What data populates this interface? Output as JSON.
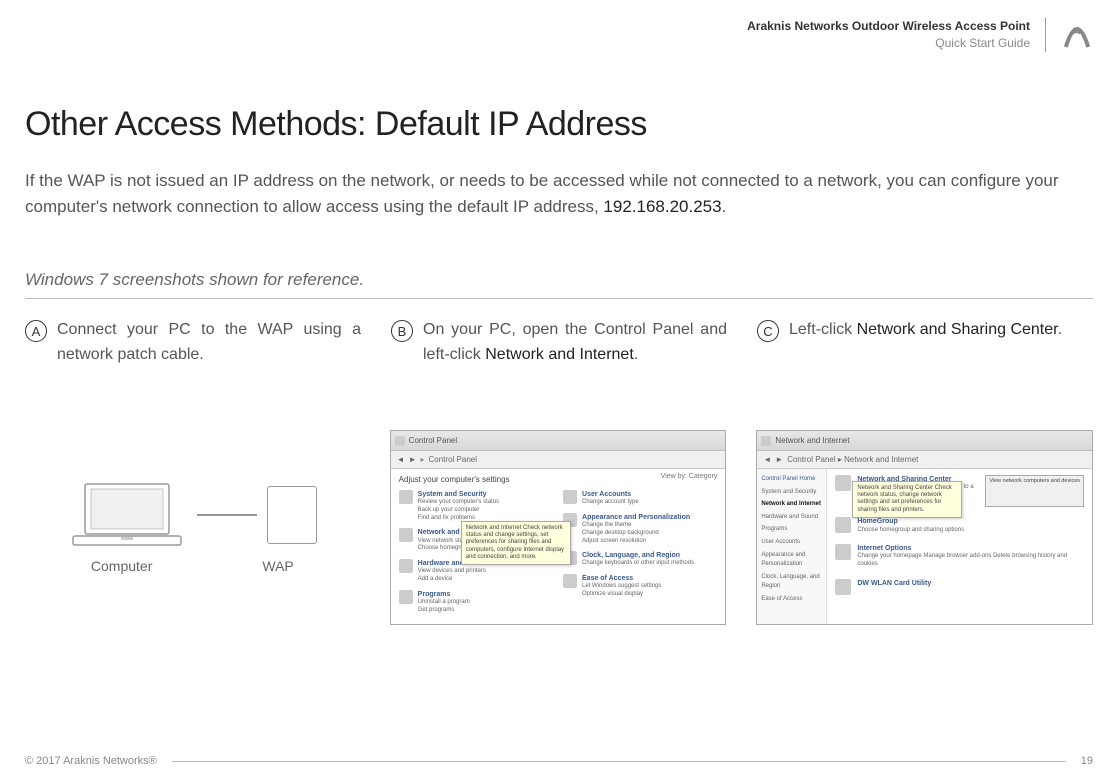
{
  "header": {
    "line1": "Araknis Networks Outdoor Wireless Access Point",
    "line2": "Quick Start Guide"
  },
  "title": "Other Access Methods: Default IP Address",
  "intro": {
    "part1": "If the WAP is not issued an IP address on the network, or needs to be accessed while not connected to a network, you can configure your computer's network connection to allow access using the default IP address, ",
    "ip": "192.168.20.253",
    "part2": "."
  },
  "caption": "Windows 7 screenshots shown for reference.",
  "steps": {
    "a": {
      "letter": "A",
      "text": "Connect your PC to the WAP using a network patch cable."
    },
    "b": {
      "letter": "B",
      "pre": "On your PC, open the Control Panel and left-click ",
      "bold": "Network and Internet",
      "post": "."
    },
    "c": {
      "letter": "C",
      "pre": "Left-click ",
      "bold": "Network and Sharing Center",
      "post": "."
    }
  },
  "diagramA": {
    "computerLabel": "Computer",
    "wapLabel": "WAP"
  },
  "screenshotB": {
    "titlebar": "Control Panel",
    "breadcrumb_arrow": "▸",
    "breadcrumb": "Control Panel",
    "heading": "Adjust your computer's settings",
    "viewby": "View by: Category",
    "cats": [
      {
        "title": "System and Security",
        "sub": "Review your computer's status\nBack up your computer\nFind and fix problems"
      },
      {
        "title": "Network and Internet",
        "sub": "View network status and tasks\nChoose homegroup and sharing options"
      },
      {
        "title": "Hardware and Sound",
        "sub": "View devices and printers\nAdd a device"
      },
      {
        "title": "Programs",
        "sub": "Uninstall a program\nGet programs"
      }
    ],
    "cats_right": [
      {
        "title": "User Accounts",
        "sub": "Change account type"
      },
      {
        "title": "Appearance and Personalization",
        "sub": "Change the theme\nChange desktop background\nAdjust screen resolution"
      },
      {
        "title": "Clock, Language, and Region",
        "sub": "Change keyboards or other input methods"
      },
      {
        "title": "Ease of Access",
        "sub": "Let Windows suggest settings\nOptimize visual display"
      }
    ],
    "tooltip": "Network and Internet\nCheck network status and change settings, set preferences for sharing files and computers, configure Internet display and connection, and more."
  },
  "screenshotC": {
    "titlebar": "Network and Internet",
    "breadcrumb": "Control Panel  ▸  Network and Internet",
    "sidebar_title": "Control Panel Home",
    "sidebar": [
      "System and Security",
      "Network and Internet",
      "Hardware and Sound",
      "Programs",
      "User Accounts",
      "Appearance and Personalization",
      "Clock, Language, and Region",
      "Ease of Access"
    ],
    "items": [
      {
        "title": "Network and Sharing Center",
        "sub": "View network status and tasks    Connect to a network\nAdd a wireless device to the network"
      },
      {
        "title": "HomeGroup",
        "sub": "Choose homegroup and sharing options"
      },
      {
        "title": "Internet Options",
        "sub": "Change your homepage    Manage browser add-ons    Delete browsing history and cookies"
      },
      {
        "title": "DW WLAN Card Utility",
        "sub": ""
      }
    ],
    "tooltip": "Network and Sharing Center\nCheck network status, change network settings and set preferences for sharing files and printers.",
    "button": "View network computers and devices"
  },
  "footer": {
    "copyright": "© 2017 Araknis Networks®",
    "page": "19"
  }
}
